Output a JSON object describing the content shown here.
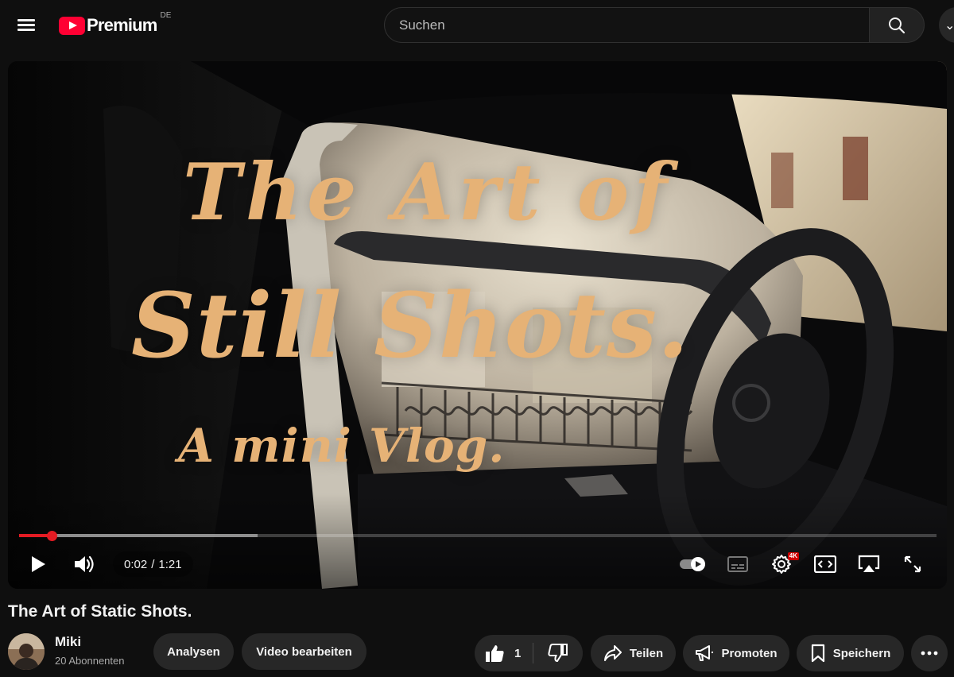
{
  "header": {
    "logo_text": "Premium",
    "logo_region": "DE",
    "search_placeholder": "Suchen"
  },
  "player": {
    "overlay_title": [
      "The Art of",
      "Still Shots.",
      "A mini Vlog."
    ],
    "current_time": "0:02",
    "time_separator": "/",
    "duration": "1:21",
    "progress_fraction": 0.0354,
    "buffered_fraction": 0.26,
    "settings_badge": "4K",
    "colors": {
      "progress_played": "#e31b23",
      "title_overlay": "#e6b276"
    },
    "icons": [
      "play-icon",
      "volume-icon",
      "autoplay-toggle-icon",
      "subtitles-icon",
      "settings-gear-icon",
      "theater-mode-icon",
      "airplay-icon",
      "fullscreen-icon"
    ]
  },
  "video": {
    "title": "The Art of Static Shots."
  },
  "channel": {
    "name": "Miki",
    "subscribers": "20 Abonnenten"
  },
  "actions": {
    "analytics_label": "Analysen",
    "edit_label": "Video bearbeiten",
    "like_count": "1",
    "share_label": "Teilen",
    "promote_label": "Promoten",
    "save_label": "Speichern"
  }
}
